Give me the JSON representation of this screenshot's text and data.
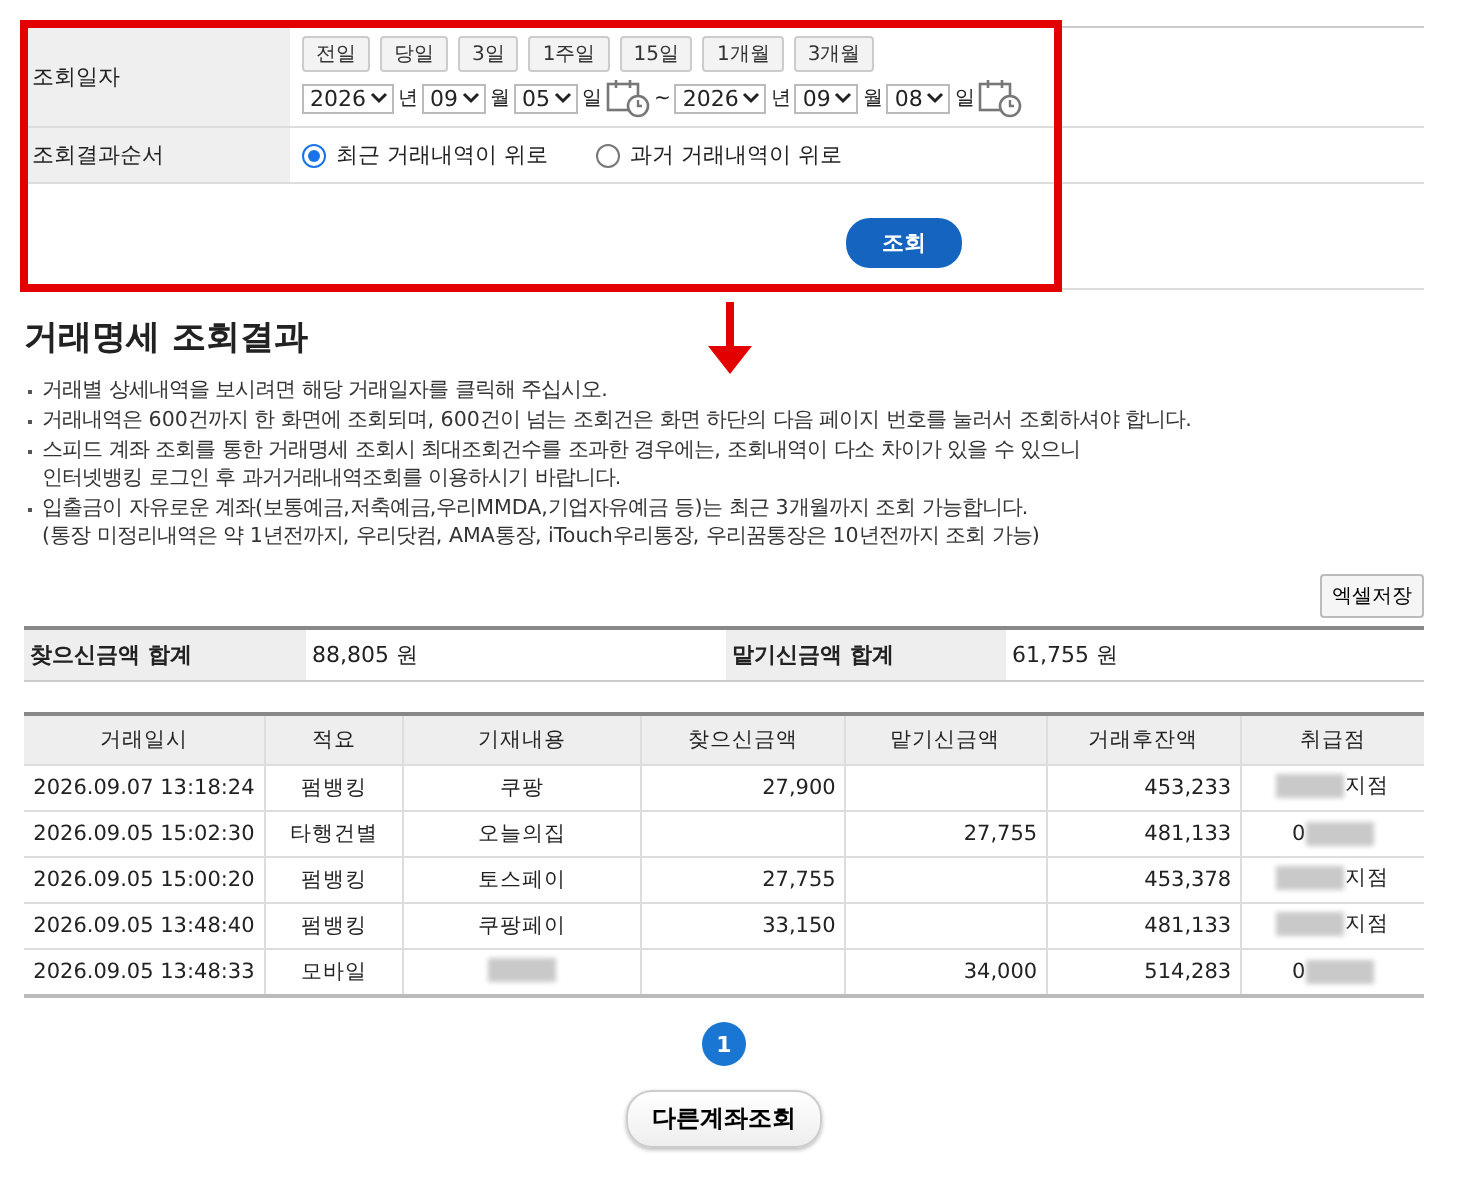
{
  "search_form": {
    "date_label": "조회일자",
    "period_buttons": [
      "전일",
      "당일",
      "3일",
      "1주일",
      "15일",
      "1개월",
      "3개월"
    ],
    "from": {
      "year": "2026",
      "year_unit": "년",
      "month": "09",
      "month_unit": "월",
      "day": "05",
      "day_unit": "일"
    },
    "range_separator": "~",
    "to": {
      "year": "2026",
      "year_unit": "년",
      "month": "09",
      "month_unit": "월",
      "day": "08",
      "day_unit": "일"
    },
    "order_label": "조회결과순서",
    "order_options": [
      {
        "label": "최근 거래내역이 위로",
        "selected": true
      },
      {
        "label": "과거 거래내역이 위로",
        "selected": false
      }
    ],
    "submit": "조회"
  },
  "results": {
    "title": "거래명세 조회결과",
    "notes": [
      {
        "lines": [
          "거래별 상세내역을 보시려면 해당 거래일자를 클릭해 주십시오."
        ]
      },
      {
        "lines": [
          "거래내역은 600건까지 한 화면에 조회되며, 600건이 넘는 조회건은 화면 하단의 다음 페이지 번호를 눌러서 조회하셔야 합니다."
        ]
      },
      {
        "lines": [
          "스피드 계좌 조회를 통한 거래명세 조회시 최대조회건수를 조과한 경우에는, 조회내역이 다소 차이가 있을 수 있으니",
          "인터넷뱅킹 로그인 후 과거거래내역조회를 이용하시기 바랍니다."
        ]
      },
      {
        "lines": [
          "입출금이 자유로운 계좌(보통예금,저축예금,우리MMDA,기업자유예금 등)는 최근 3개월까지 조회 가능합니다.",
          "(통장 미정리내역은 약 1년전까지, 우리닷컴, AMA통장, iTouch우리통장, 우리꿈통장은 10년전까지 조회 가능)"
        ]
      }
    ],
    "excel_button": "엑셀저장",
    "totals": [
      {
        "label": "찾으신금액 합계",
        "value": "88,805 원"
      },
      {
        "label": "맡기신금액 합계",
        "value": "61,755 원"
      }
    ],
    "table": {
      "columns": [
        "거래일시",
        "적요",
        "기재내용",
        "찾으신금액",
        "맡기신금액",
        "거래후잔액",
        "취급점"
      ],
      "rows": [
        {
          "date": "2026.09.07 13:18:24",
          "type": "펌뱅킹",
          "memo": "쿠팡",
          "withdrawal": "27,900",
          "balance": "453,233",
          "branch": "지점",
          "memo_blurred": false,
          "branch_prefix_blurred": true,
          "branch_suffix_blurred": false
        },
        {
          "date": "2026.09.05 15:02:30",
          "type": "타행건별",
          "memo": "오늘의집",
          "deposit": "27,755",
          "balance": "481,133",
          "branch": "0",
          "memo_blurred": false,
          "branch_prefix_blurred": false,
          "branch_suffix_blurred": true
        },
        {
          "date": "2026.09.05 15:00:20",
          "type": "펌뱅킹",
          "memo": "토스페이",
          "withdrawal": "27,755",
          "balance": "453,378",
          "branch": "지점",
          "memo_blurred": false,
          "branch_prefix_blurred": true,
          "branch_suffix_blurred": false
        },
        {
          "date": "2026.09.05 13:48:40",
          "type": "펌뱅킹",
          "memo": "쿠팡페이",
          "withdrawal": "33,150",
          "balance": "481,133",
          "branch": "지점",
          "memo_blurred": false,
          "branch_prefix_blurred": true,
          "branch_suffix_blurred": false
        },
        {
          "date": "2026.09.05 13:48:33",
          "type": "모바일",
          "deposit": "34,000",
          "balance": "514,283",
          "branch": "0",
          "memo_blurred": true,
          "branch_prefix_blurred": false,
          "branch_suffix_blurred": true
        }
      ]
    }
  },
  "pagination": [
    {
      "label": "1",
      "selected": true
    }
  ],
  "other_account_button": "다른계좌조회"
}
